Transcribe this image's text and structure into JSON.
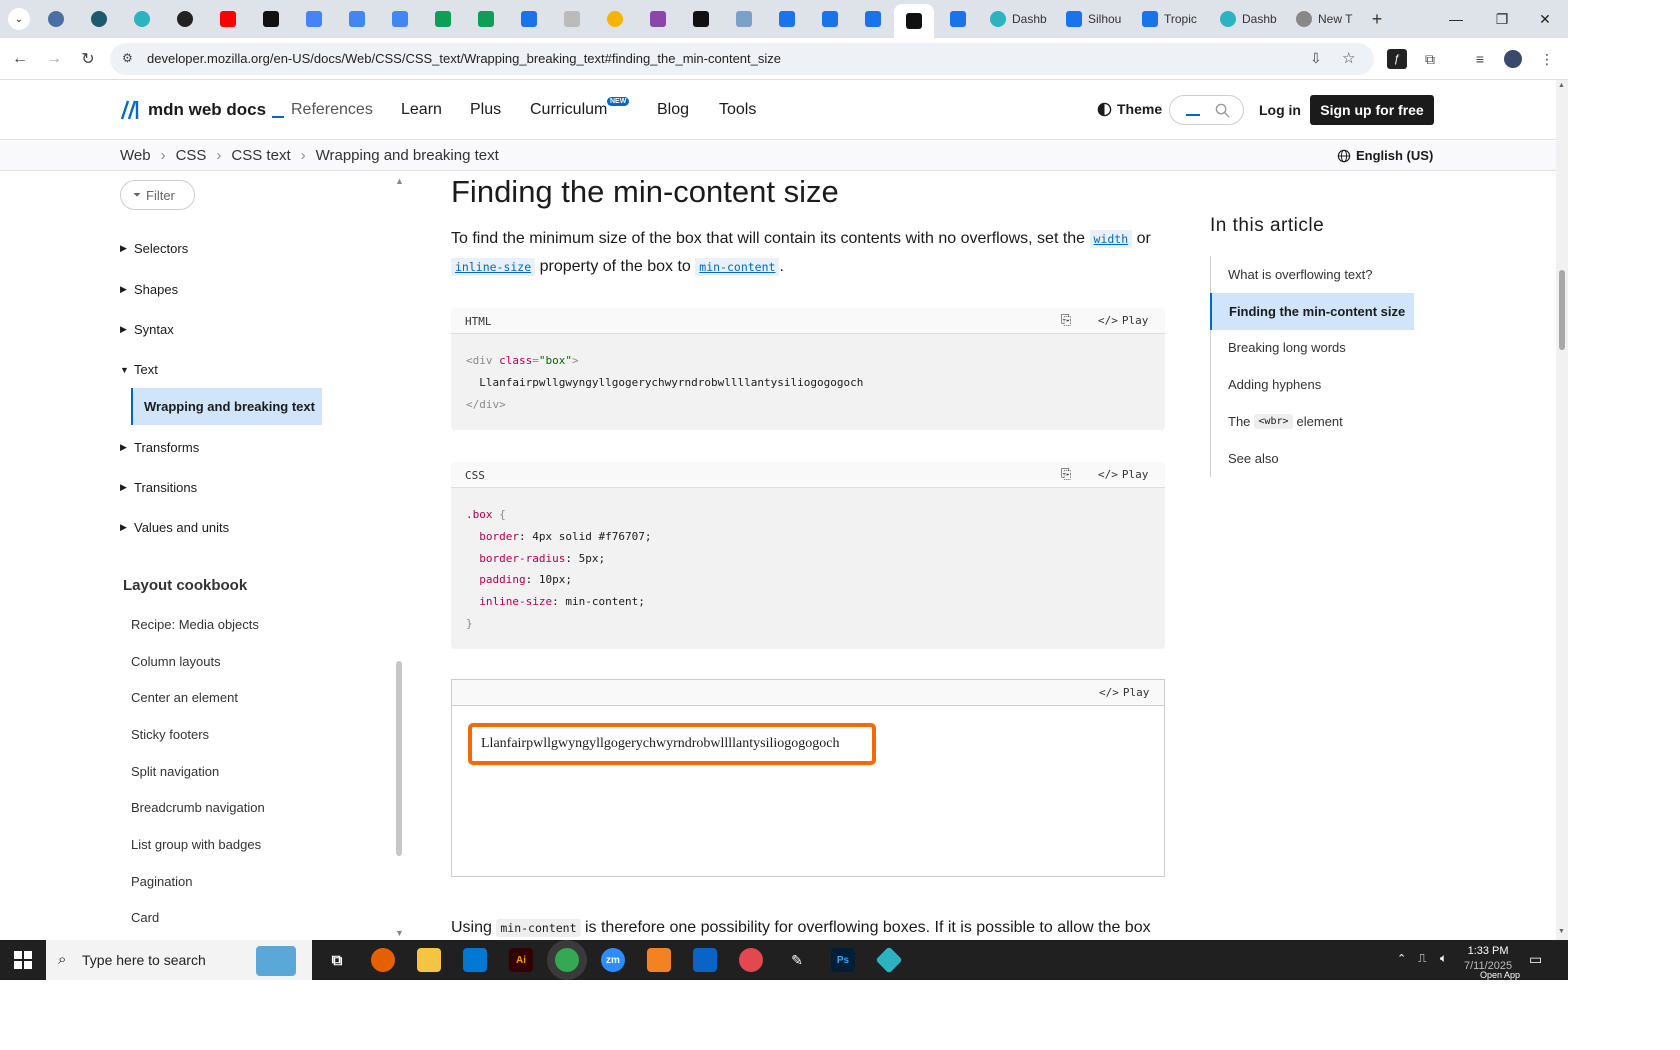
{
  "browser": {
    "tabs": [
      {
        "label": "Dashb",
        "color": "#2bb3c0"
      },
      {
        "label": "Silhou",
        "color": "#1a73e8"
      },
      {
        "label": "Tropic",
        "color": "#1a73e8"
      },
      {
        "label": "Dashb",
        "color": "#2bb3c0"
      },
      {
        "label": "New T",
        "color": "#666666"
      }
    ],
    "new_tab": "+",
    "url": "developer.mozilla.org/en-US/docs/Web/CSS/CSS_text/Wrapping_breaking_text#finding_the_min-content_size"
  },
  "header": {
    "logo": "mdn web docs",
    "nav": [
      "References",
      "Learn",
      "Plus",
      "Curriculum",
      "Blog",
      "Tools"
    ],
    "new_badge": "NEW",
    "theme": "Theme",
    "login": "Log in",
    "signup": "Sign up for free"
  },
  "breadcrumb": {
    "items": [
      "Web",
      "CSS",
      "CSS text",
      "Wrapping and breaking text"
    ],
    "sep": "›",
    "language": "English (US)"
  },
  "sidebar": {
    "filter_placeholder": "Filter",
    "items": [
      "Selectors",
      "Shapes",
      "Syntax",
      "Text",
      "Transforms",
      "Transitions",
      "Values and units"
    ],
    "active_item": "Wrapping and breaking text",
    "cookbook_title": "Layout cookbook",
    "cookbook_items": [
      "Recipe: Media objects",
      "Column layouts",
      "Center an element",
      "Sticky footers",
      "Split navigation",
      "Breadcrumb navigation",
      "List group with badges",
      "Pagination",
      "Card"
    ]
  },
  "main": {
    "heading": "Finding the min-content size",
    "intro_1": "To find the minimum size of the box that will contain its contents with no overflows, set the",
    "code_width": "width",
    "intro_or": "or",
    "code_inline_size": "inline-size",
    "intro_2": "property of the box to",
    "code_min_content": "min-content",
    "intro_end": ".",
    "html_label": "HTML",
    "css_label": "CSS",
    "play": "Play",
    "html_code": {
      "open_tag_start": "<div ",
      "attr": "class",
      "eq": "=",
      "attr_val": "\"box\"",
      "open_tag_end": ">",
      "content": "Llanfairpwllgwyngyllgogerychwyrndrobwllllantysiliogogogoch",
      "close_tag": "</div>"
    },
    "css_code": {
      "selector": ".box",
      "open": "{",
      "close": "}",
      "rules": [
        {
          "prop": "border",
          "value": "4px solid #f76707;"
        },
        {
          "prop": "border-radius",
          "value": "5px;"
        },
        {
          "prop": "padding",
          "value": "10px;"
        },
        {
          "prop": "inline-size",
          "value": "min-content;"
        }
      ]
    },
    "demo_text": "Llanfairpwllgwyngyllgogerychwyrndrobwllllantysiliogogogoch",
    "outro_1": "Using",
    "code_min_content_2": "min-content",
    "outro_2": "is therefore one possibility for overflowing boxes. If it is possible to allow the box"
  },
  "toc": {
    "title": "In this article",
    "items": [
      "What is overflowing text?",
      "Finding the min-content size",
      "Breaking long words",
      "Adding hyphens",
      "The",
      "element",
      "See also"
    ],
    "wbr": "<wbr>"
  },
  "taskbar": {
    "search_placeholder": "Type here to search",
    "time": "1:33 PM",
    "date": "7/11/2025",
    "open_app": "Open App"
  },
  "colors": {
    "accent": "#0069c2",
    "demo_border": "#f76707",
    "dark": "#1b1b1b"
  }
}
